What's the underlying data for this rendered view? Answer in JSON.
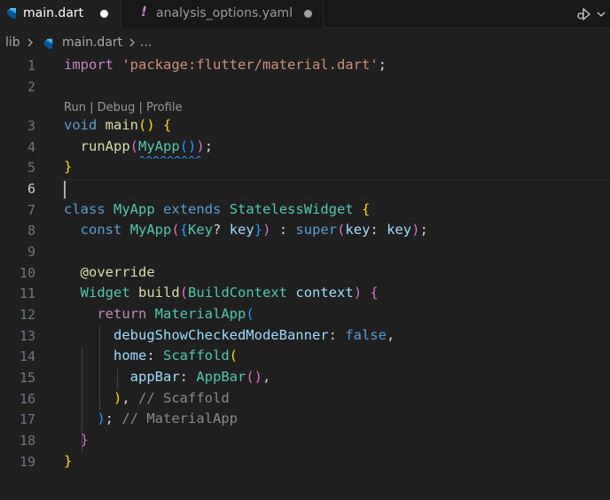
{
  "tabs": [
    {
      "label": "main.dart",
      "icon": "dart-icon",
      "modified": true,
      "active": true
    },
    {
      "label": "analysis_options.yaml",
      "icon": "exclamation-icon",
      "icon_glyph": "!",
      "modified": true,
      "active": false
    }
  ],
  "breadcrumb": {
    "folder": "lib",
    "file": "main.dart",
    "more": "..."
  },
  "codelens": {
    "run": "Run",
    "debug": "Debug",
    "profile": "Profile",
    "separator": " | "
  },
  "gutter": {
    "numbers": [
      "1",
      "2",
      "3",
      "4",
      "5",
      "6",
      "7",
      "8",
      "9",
      "10",
      "11",
      "12",
      "13",
      "14",
      "15",
      "16",
      "17",
      "18",
      "19"
    ],
    "active_line": "6"
  },
  "code": {
    "l1": {
      "a": "import",
      "b": " ",
      "c": "'package:flutter/material.dart'",
      "d": ";"
    },
    "l3": {
      "a": "void",
      "b": " ",
      "c": "main",
      "d": "()",
      "e": " ",
      "f": "{"
    },
    "l4": {
      "a": "  ",
      "b": "runApp",
      "c": "(",
      "d": "MyApp",
      "e": "()",
      "f": ")",
      "g": ";"
    },
    "l5": {
      "a": "}"
    },
    "l7": {
      "a": "class",
      "b": " ",
      "c": "MyApp",
      "d": " ",
      "e": "extends",
      "f": " ",
      "g": "StatelessWidget",
      "h": " ",
      "i": "{"
    },
    "l8": {
      "a": "  ",
      "b": "const",
      "c": " ",
      "d": "MyApp",
      "e": "(",
      "f": "{",
      "g": "Key",
      "h": "? ",
      "i": "key",
      "j": "}",
      "k": ")",
      "l": " : ",
      "m": "super",
      "n": "(",
      "o": "key",
      "p": ": ",
      "q": "key",
      "r": ")",
      "s": ";"
    },
    "l10": {
      "a": "  ",
      "b": "@override"
    },
    "l11": {
      "a": "  ",
      "b": "Widget",
      "c": " ",
      "d": "build",
      "e": "(",
      "f": "BuildContext",
      "g": " ",
      "h": "context",
      "i": ")",
      "j": " ",
      "k": "{"
    },
    "l12": {
      "a": "    ",
      "b": "return",
      "c": " ",
      "d": "MaterialApp",
      "e": "("
    },
    "l13": {
      "a": "      ",
      "b": "debugShowCheckedModeBanner",
      "c": ": ",
      "d": "false",
      "e": ","
    },
    "l14": {
      "a": "      ",
      "b": "home",
      "c": ": ",
      "d": "Scaffold",
      "e": "("
    },
    "l15": {
      "a": "        ",
      "b": "appBar",
      "c": ": ",
      "d": "AppBar",
      "e": "()",
      "f": ","
    },
    "l16": {
      "a": "      ",
      "b": ")",
      "c": ", ",
      "d": "// Scaffold"
    },
    "l17": {
      "a": "    ",
      "b": ")",
      "c": "; ",
      "d": "// MaterialApp"
    },
    "l18": {
      "a": "  ",
      "b": "}"
    },
    "l19": {
      "a": "}"
    }
  },
  "colors": {
    "accent_dart": "#4fc3f7",
    "background": "#1f1f1f",
    "tabbar": "#181818"
  }
}
